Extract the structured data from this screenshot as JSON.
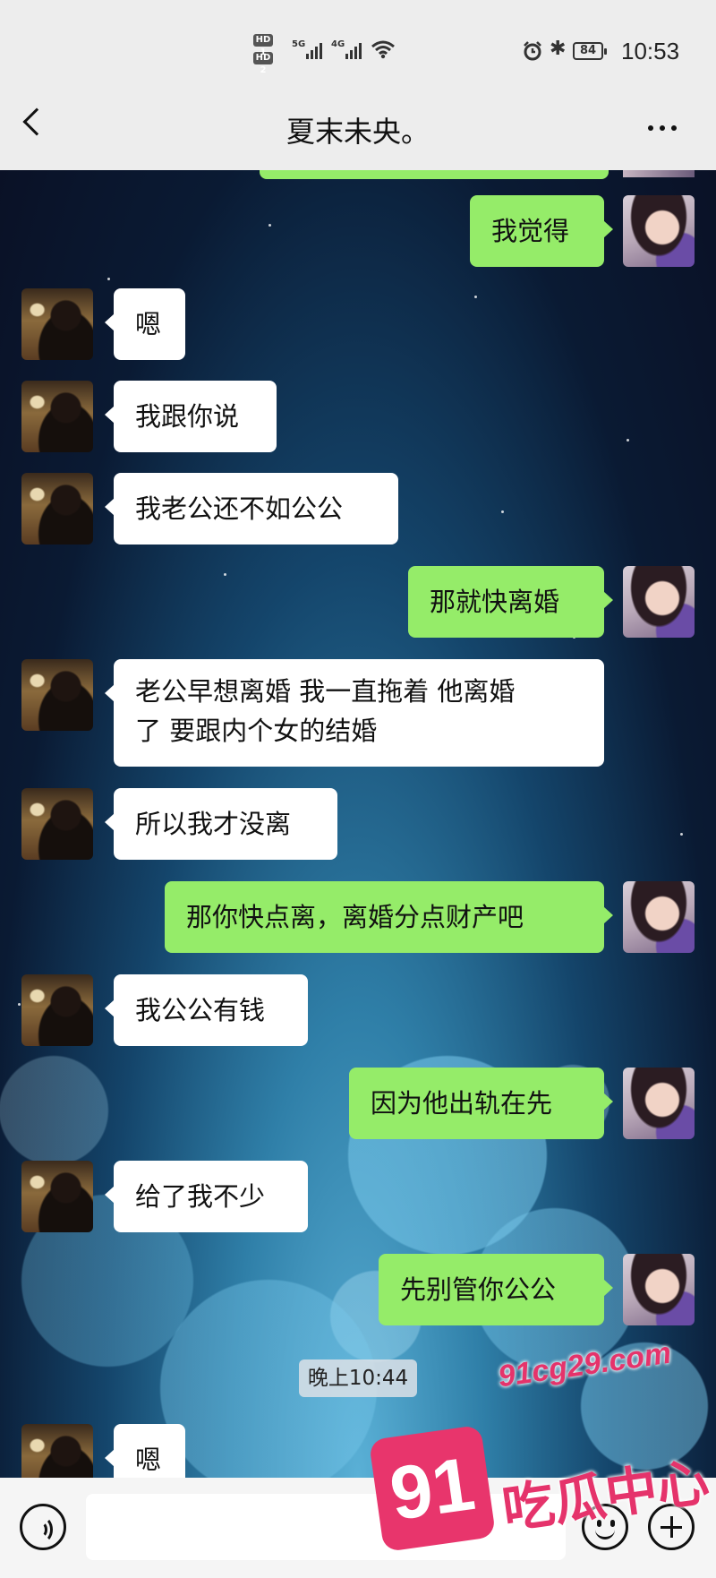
{
  "status_bar": {
    "sim1": "HD 1",
    "sim2": "HD 2",
    "network1": "5G",
    "network2": "4G",
    "battery": "84",
    "time": "10:53"
  },
  "header": {
    "title": "夏末未央。"
  },
  "messages": [
    {
      "side": "right",
      "text": "我觉得"
    },
    {
      "side": "left",
      "text": "嗯"
    },
    {
      "side": "left",
      "text": "我跟你说"
    },
    {
      "side": "left",
      "text": "我老公还不如公公"
    },
    {
      "side": "right",
      "text": "那就快离婚"
    },
    {
      "side": "left",
      "text_line1": "老公早想离婚 我一直拖着 他离婚",
      "text_line2": "了 要跟内个女的结婚"
    },
    {
      "side": "left",
      "text": "所以我才没离"
    },
    {
      "side": "right",
      "text": "那你快点离，离婚分点财产吧"
    },
    {
      "side": "left",
      "text": "我公公有钱"
    },
    {
      "side": "right",
      "text": "因为他出轨在先"
    },
    {
      "side": "left",
      "text": "给了我不少"
    },
    {
      "side": "right",
      "text": "先别管你公公"
    },
    {
      "side": "left",
      "text": "嗯"
    }
  ],
  "timestamp": "晚上10:44",
  "watermark": {
    "url": "91cg29.com",
    "badge": "91",
    "name": "吃瓜中心"
  },
  "icons": {
    "back": "chevron-left-icon",
    "more": "more-dots-icon",
    "voice": "voice-icon",
    "emoji": "emoji-icon",
    "plus": "plus-icon"
  },
  "colors": {
    "sent_bubble": "#95ec69",
    "received_bubble": "#ffffff",
    "watermark": "#e5336b"
  }
}
